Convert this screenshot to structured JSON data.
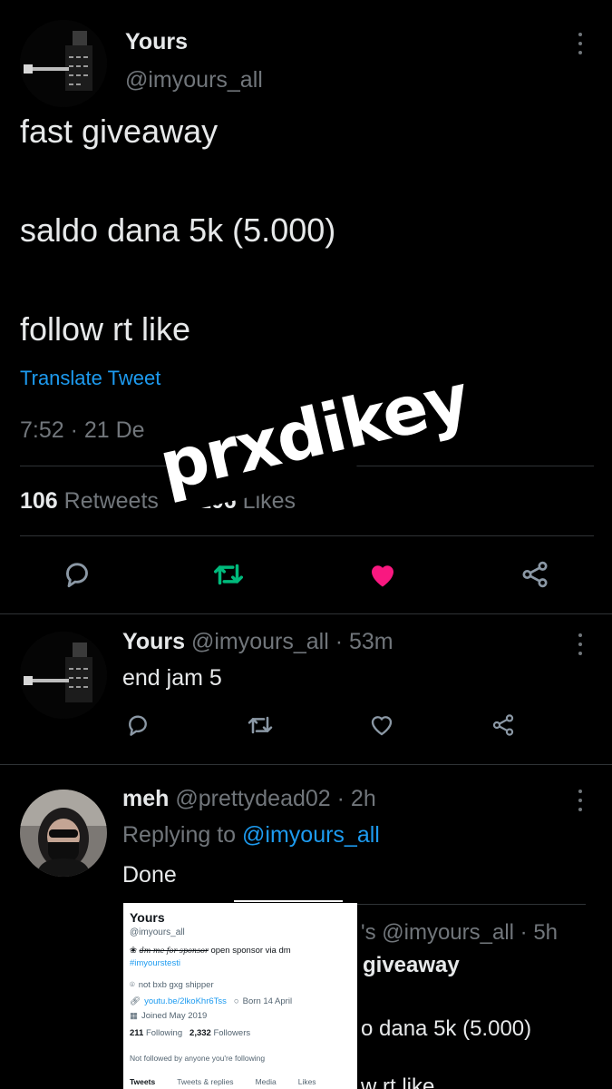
{
  "main_tweet": {
    "display_name": "Yours",
    "handle": "@imyours_all",
    "lines": [
      "fast giveaway",
      "saldo dana 5k (5.000)",
      "follow rt like"
    ],
    "translate_label": "Translate Tweet",
    "timestamp": "7:52 · 21 De",
    "retweets_count": "106",
    "retweets_label": "Retweets",
    "likes_count": "106",
    "likes_label": "Likes"
  },
  "sticker": {
    "text": "prxdikey"
  },
  "reply1": {
    "display_name": "Yours",
    "handle": "@imyours_all",
    "time": "· 53m",
    "text": "end jam 5"
  },
  "reply2": {
    "display_name": "meh",
    "handle": "@prettydead02",
    "time": "· 2h",
    "replying_prefix": "Replying to",
    "replying_handle": "@imyours_all",
    "text": "Done"
  },
  "embedded_profile": {
    "name": "Yours",
    "handle": "@imyours_all",
    "bio_script": "dm me for sponsor",
    "bio": "open sponsor via dm",
    "hashtag": "#imyourstesti",
    "location": "not bxb gxg shipper",
    "link": "youtu.be/2lkoKhr6Tss",
    "born": "Born 14 April",
    "joined": "Joined May 2019",
    "following_count": "211",
    "following_label": "Following",
    "followers_count": "2,332",
    "followers_label": "Followers",
    "note": "Not followed by anyone you're following",
    "tabs": [
      "Tweets",
      "Tweets & replies",
      "Media",
      "Likes"
    ]
  },
  "embedded_tweet": {
    "header_fragment": "'s @imyours_all · 5h",
    "line1": "giveaway",
    "line2": "o dana 5k (5.000)",
    "line3": "w rt like"
  },
  "colors": {
    "background": "#000000",
    "text": "#e7e9ea",
    "secondary": "#71767b",
    "link": "#1d9bf0",
    "retweet_active": "#00ba7c",
    "like_active": "#f91880",
    "divider": "#2f3336"
  }
}
